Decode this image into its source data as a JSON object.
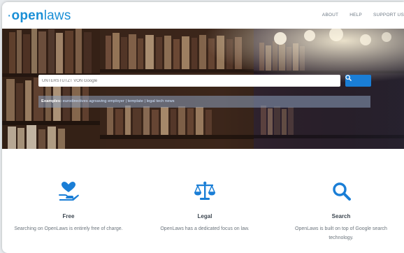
{
  "brand": {
    "logo_prefix": "·",
    "logo_bold": "open",
    "logo_rest": "laws",
    "color": "#1a8fd6"
  },
  "nav": {
    "links": [
      "ABOUT",
      "HELP",
      "SUPPORT US"
    ]
  },
  "search": {
    "placeholder": "UNTERSTÜTZT VON Google",
    "button_icon": "search-icon",
    "examples_label": "Examples:",
    "examples_text": "eurodirectives agrsaving employer | template | legal tech news"
  },
  "features": [
    {
      "icon": "heart-hand-icon",
      "title": "Free",
      "desc": "Searching on OpenLaws is entirely free of charge."
    },
    {
      "icon": "scales-icon",
      "title": "Legal",
      "desc": "OpenLaws has a dedicated focus on law."
    },
    {
      "icon": "search-icon",
      "title": "Search",
      "desc": "OpenLaws is built on top of Google search technology."
    }
  ],
  "colors": {
    "accent": "#1a7ed6",
    "text": "#3c4650"
  }
}
